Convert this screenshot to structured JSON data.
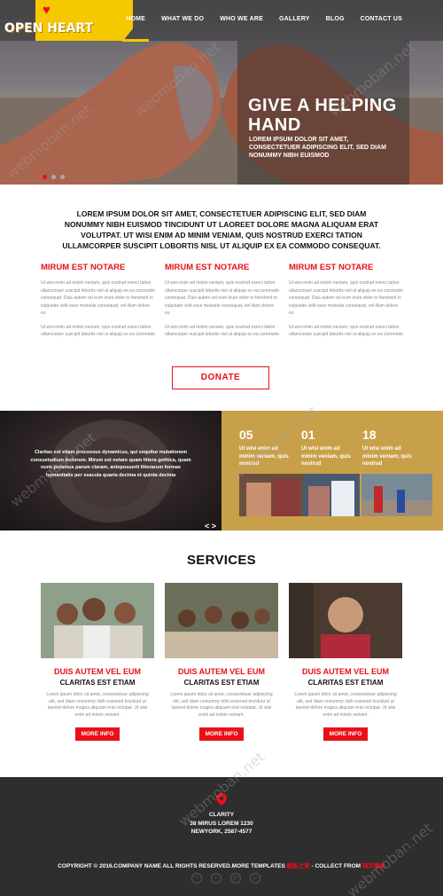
{
  "header": {
    "logo_text": "OPEN HEART",
    "nav": [
      "HOME",
      "WHAT WE DO",
      "WHO WE ARE",
      "GALLERY",
      "BLOG",
      "CONTACT US"
    ]
  },
  "hero": {
    "title": "GIVE A HELPING HAND",
    "subtitle": "LOREM IPSUM DOLOR SIT AMET, CONSECTETUER ADIPISCING ELIT, SED DIAM NONUMMY NIBH EUISMOD",
    "slides": 3,
    "active_slide": 1
  },
  "intro": {
    "text": "LOREM IPSUM DOLOR SIT AMET, CONSECTETUER ADIPISCING ELIT, SED DIAM NONUMMY NIBH EUISMOD TINCIDUNT UT LAOREET DOLORE MAGNA ALIQUAM ERAT VOLUTPAT. UT WISI ENIM AD MINIM VENIAM, QUIS NOSTRUD EXERCI TATION ULLAMCORPER SUSCIPIT LOBORTIS NISL UT ALIQUIP EX EA COMMODO CONSEQUAT."
  },
  "columns": [
    {
      "title": "MIRUM EST NOTARE",
      "p1": "Ut wisi enim ad minim veniam, quis nostrud exerci tation ullamcorper suscipit lobortis nisl ut aliquip ex ea commodo consequat. Duis autem vel eum iriure dolor in hendrerit in vulputate velit esse molestie consequat, vel illum dolore eu",
      "p2": "Ut wisi enim ad minim veniam, quis nostrud exerci tation ullamcorper suscipit lobortis nisl ut aliquip ex ea commodo"
    },
    {
      "title": "MIRUM EST NOTARE",
      "p1": "Ut wisi enim ad minim veniam, quis nostrud exerci tation ullamcorper suscipit lobortis nisl ut aliquip ex ea commodo consequat. Duis autem vel eum iriure dolor in hendrerit in vulputate velit esse molestie consequat, vel illum dolore eu",
      "p2": "Ut wisi enim ad minim veniam, quis nostrud exerci tation ullamcorper suscipit lobortis nisl ut aliquip ex ea commodo"
    },
    {
      "title": "MIRUM EST NOTARE",
      "p1": "Ut wisi enim ad minim veniam, quis nostrud exerci tation ullamcorper suscipit lobortis nisl ut aliquip ex ea commodo consequat. Duis autem vel eum iriure dolor in hendrerit in vulputate velit esse molestie consequat, vel illum dolore eu",
      "p2": "Ut wisi enim ad minim veniam, quis nostrud exerci tation ullamcorper suscipit lobortis nisl ut aliquip ex ea commodo"
    }
  ],
  "donate_label": "DONATE",
  "band": {
    "quote": "Claritas est etiam processus dynamicus, qui sequitur mutationem consuetudium lectorum. Mirum est notare quam littera gothica, quam nunc putamus parum claram, anteposuerit litterarum formas humanitatis per seacula quarta decima et quinta decima",
    "arrows": "< >",
    "stats": [
      {
        "num": "05",
        "label": "Ut wisi enim ad minim veniam, quis nostrud"
      },
      {
        "num": "01",
        "label": "Ut wisi enim ad minim veniam, quis nostrud"
      },
      {
        "num": "18",
        "label": "Ut wisi enim ad minim veniam, quis nostrud"
      }
    ]
  },
  "services": {
    "title": "SERVICES",
    "items": [
      {
        "title": "DUIS AUTEM VEL EUM",
        "subtitle": "CLARITAS EST ETIAM",
        "text": "Lorem ipsum dolor sit amet, consectetuer adipiscing elit, sed diam nonummy nibh euismod tincidunt ut laoreet dolore magna aliquam erat volutpat. Ut wisi enim ad minim veniam,",
        "button": "MORE INFO"
      },
      {
        "title": "DUIS AUTEM VEL EUM",
        "subtitle": "CLARITAS EST ETIAM",
        "text": "Lorem ipsum dolor sit amet, consectetuer adipiscing elit, sed diam nonummy nibh euismod tincidunt ut laoreet dolore magna aliquam erat volutpat. Ut wisi enim ad minim veniam,",
        "button": "MORE INFO"
      },
      {
        "title": "DUIS AUTEM VEL EUM",
        "subtitle": "CLARITAS EST ETIAM",
        "text": "Lorem ipsum dolor sit amet, consectetuer adipiscing elit, sed diam nonummy nibh euismod tincidunt ut laoreet dolore magna aliquam erat volutpat. Ut wisi enim ad minim veniam,",
        "button": "MORE INFO"
      }
    ]
  },
  "footer": {
    "address_line1": "CLARITY",
    "address_line2": "38 MIRUS LOREM 1230",
    "address_line3": "NEWYORK, 2587-4577",
    "copyright_prefix": "COPYRIGHT © 2016.COMPANY NAME ALL RIGHTS RESERVED.MORE TEMPLATES",
    "link1": "模板之家",
    "copyright_mid": "- COLLECT FROM",
    "link2": "网页模板",
    "socials": [
      "f",
      "t",
      "g+",
      "p"
    ]
  },
  "watermark": "webmoban.net",
  "colors": {
    "accent": "#e8111a",
    "logo_bg": "#f6c800",
    "band_gold": "#c9a04a",
    "footer_bg": "#2e2e2e"
  }
}
